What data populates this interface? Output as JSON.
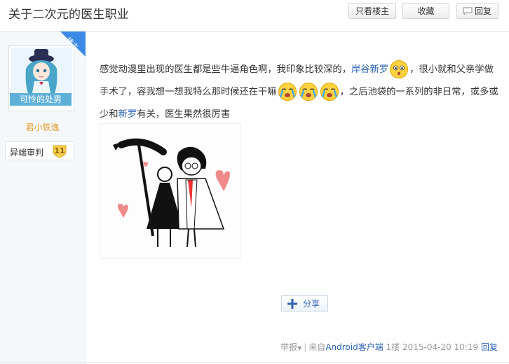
{
  "thread": {
    "title": "关于二次元的医生职业"
  },
  "toolbar": {
    "only_op_label": "只看楼主",
    "favorite_label": "收藏",
    "reply_label": "回复"
  },
  "author": {
    "avatar_caption": "可怜的处男",
    "name": "君小轶逸",
    "level_name": "异端审判",
    "level": "11",
    "op_badge": "楼主"
  },
  "post": {
    "text_1": "感觉动漫里出现的医生都是些牛逼角色啊，我印象比较深的，",
    "link_1": "岸谷新罗",
    "text_2": "，很小就和父亲学做手术了，容我想一想我特么那时候还在干嘛",
    "text_3": "，之后池袋的一系列的非日常，或多或少和",
    "link_2": "新罗",
    "text_4": "有关，医生果然很厉害"
  },
  "share": {
    "label": "分享"
  },
  "footer": {
    "report": "举报",
    "from_prefix": "来自",
    "client": "Android客户端",
    "floor": "1楼",
    "timestamp": "2015-04-20 10:19",
    "reply": "回复"
  },
  "icons": {
    "emoji_1": "surprised-face-icon",
    "emoji_2": "crying-face-icon",
    "reply": "speech-bubble-icon",
    "share": "plus-icon"
  },
  "colors": {
    "link": "#2d64b3",
    "username": "#e09a2a",
    "op_ribbon": "#3b8be6"
  }
}
